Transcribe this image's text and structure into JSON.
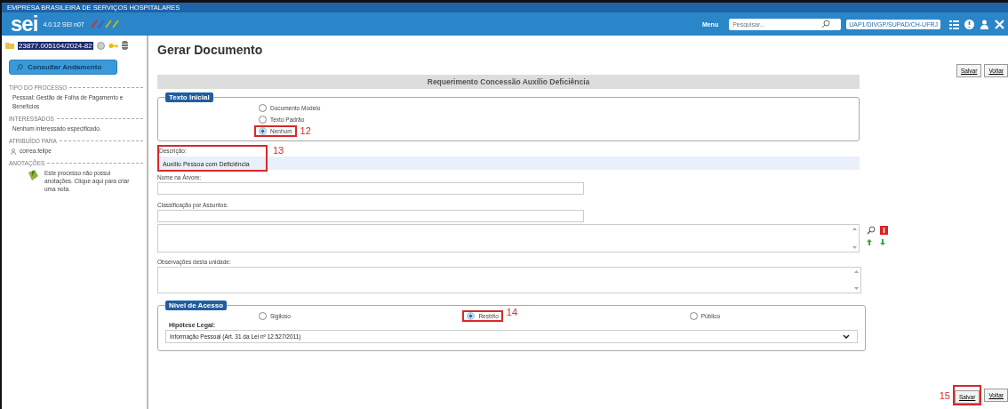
{
  "header": {
    "organization": "EMPRESA BRASILEIRA DE SERVIÇOS HOSPITALARES",
    "logo": "sei",
    "version": "4.0.12 SEI n07",
    "menu": "Menu",
    "search": {
      "placeholder": "Pesquisar..."
    },
    "unit": "UAP1/DIVGP/SUPAD/CH-UFRJ"
  },
  "sidebar": {
    "process_number": "23877.005104/2024-82",
    "consult_button": "Consultar Andamento",
    "sections": [
      {
        "title": "TIPO DO PROCESSO",
        "kind": "text",
        "text": "Pessoal: Gestão de Folha de Pagamento e Benefícios"
      },
      {
        "title": "INTERESSADOS",
        "kind": "text",
        "text": "Nenhum interessado especificado."
      },
      {
        "title": "ATRIBUÍDO PARA",
        "kind": "user",
        "text": "correa.felipe"
      },
      {
        "title": "ANOTAÇÕES",
        "kind": "note",
        "text": "Este processo não possui anotações. Clique aqui para criar uma nota."
      }
    ]
  },
  "page": {
    "title": "Gerar Documento",
    "top_buttons": [
      "Salvar",
      "Voltar"
    ],
    "document_type": "Requerimento Concessão Auxílio Deficiência",
    "initial_text": {
      "legend": "Texto Inicial",
      "options": [
        {
          "label": "Documento Modelo",
          "selected": false
        },
        {
          "label": "Texto Padrão",
          "selected": false
        },
        {
          "label": "Nenhum",
          "selected": true,
          "callout": "12"
        }
      ]
    },
    "description": {
      "label": "Descrição:",
      "value": "Auxílio Pessoa com Deficiência",
      "callout": "13"
    },
    "tree_name": {
      "label": "Nome na Árvore:"
    },
    "classification": {
      "label": "Classificação por Assuntos:"
    },
    "observations": {
      "label": "Observações desta unidade:"
    },
    "access": {
      "legend": "Nível de Acesso",
      "options": [
        {
          "label": "Sigiloso",
          "selected": false
        },
        {
          "label": "Restrito",
          "selected": true,
          "callout": "14"
        },
        {
          "label": "Público",
          "selected": false
        }
      ],
      "legal_label": "Hipótese Legal:",
      "legal_value": "Informação Pessoal (Art. 31 da Lei nº 12.527/2011)"
    },
    "bottom_buttons": [
      {
        "label": "Salvar",
        "callout": "15"
      },
      {
        "label": "Voltar"
      }
    ]
  }
}
